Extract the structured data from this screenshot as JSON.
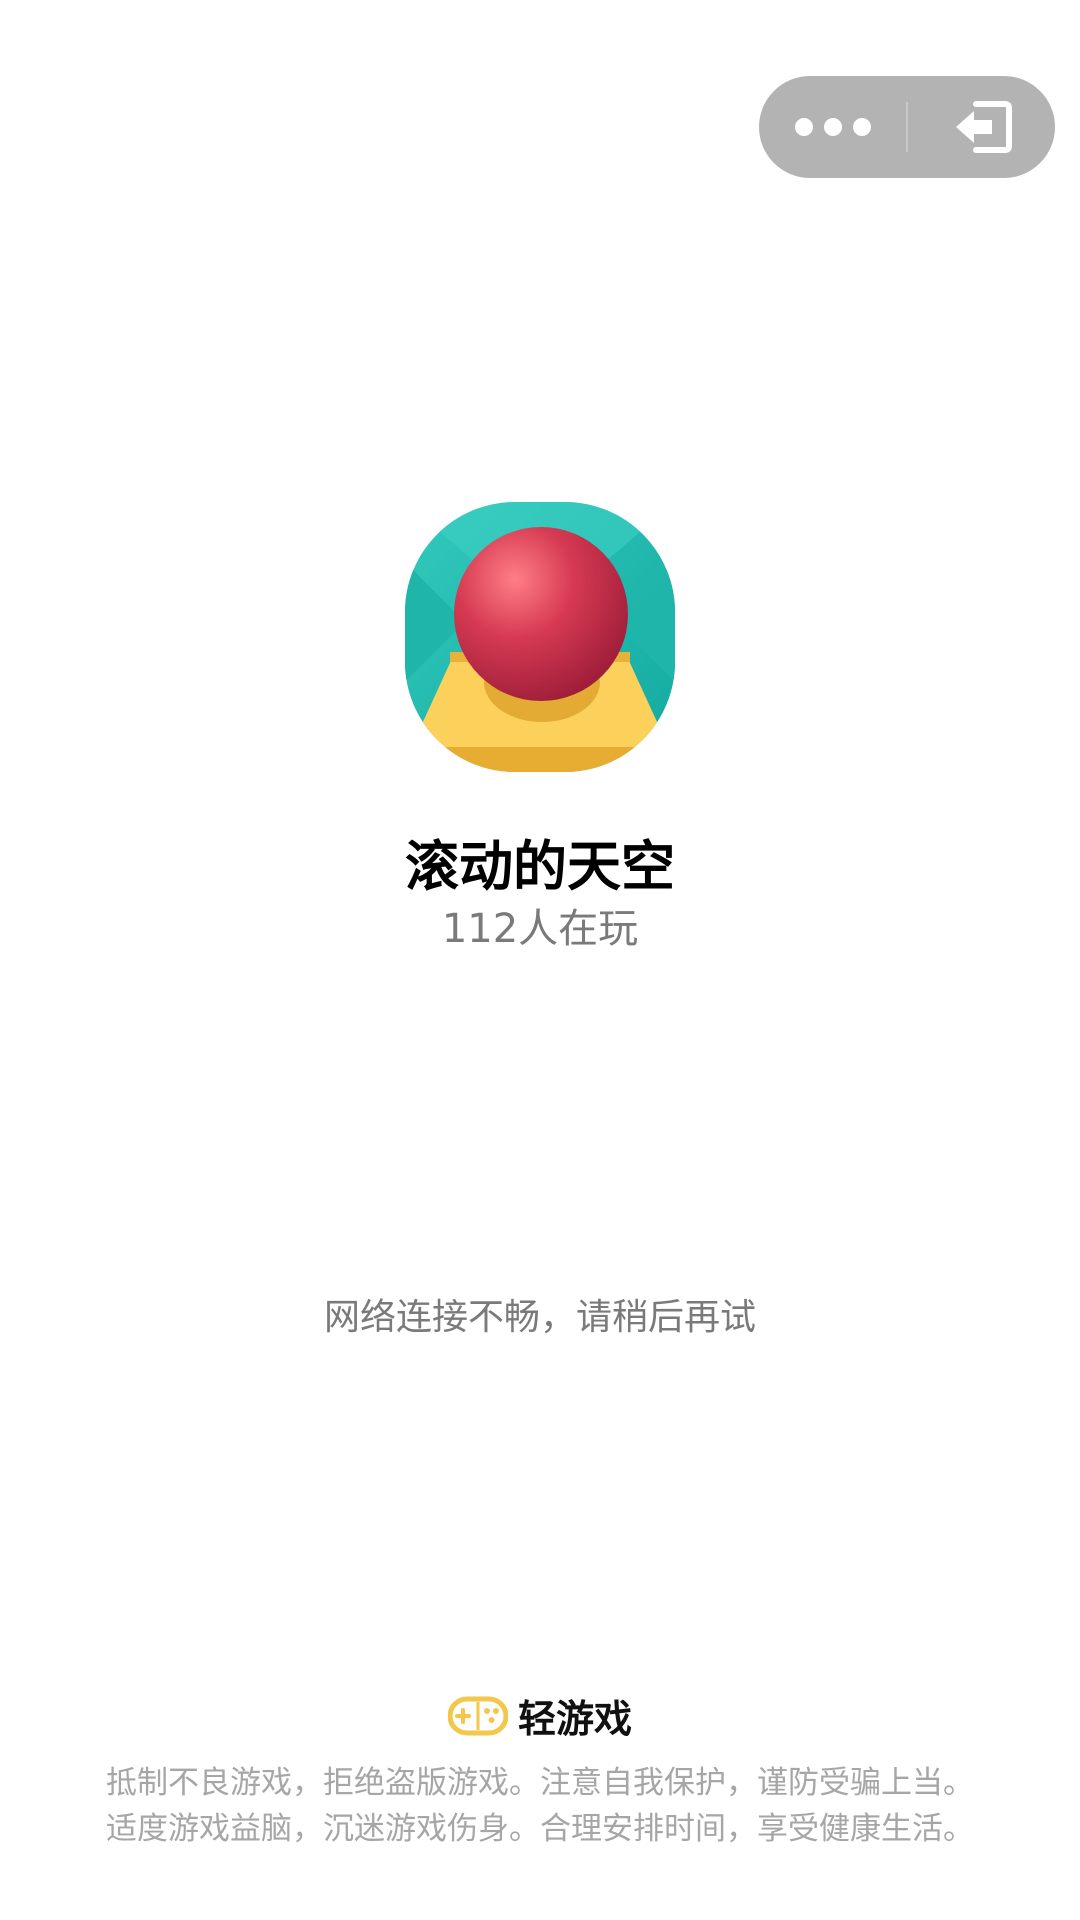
{
  "capsule": {
    "more_icon": "more-dots-icon",
    "exit_icon": "exit-arrow-icon"
  },
  "game": {
    "icon": "rolling-ball-game-icon",
    "title": "滚动的天空",
    "players": "112人在玩"
  },
  "status": {
    "message": "网络连接不畅，请稍后再试"
  },
  "footer": {
    "brand_icon": "gamepad-icon",
    "brand_name": "轻游戏",
    "notice_line1": "抵制不良游戏，拒绝盗版游戏。注意自我保护，谨防受骗上当。",
    "notice_line2": "适度游戏益脑，沉迷游戏伤身。合理安排时间，享受健康生活。"
  },
  "colors": {
    "capsule_bg": "#b3b3b3",
    "brand_yellow": "#f2c74a",
    "icon_teal": "#1db8ad",
    "ball_red": "#c8324a"
  }
}
